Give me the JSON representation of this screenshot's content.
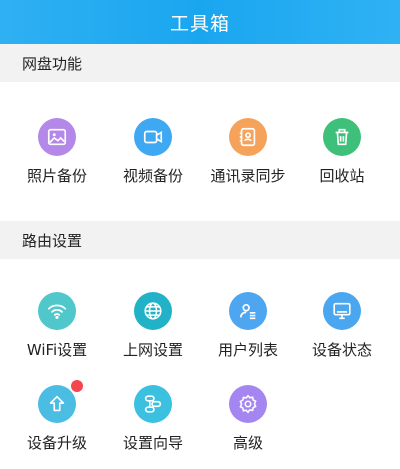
{
  "header": {
    "title": "工具箱"
  },
  "sections": [
    {
      "title": "网盘功能",
      "items": [
        {
          "label": "照片备份",
          "icon": "photo-icon",
          "color": "#b388e8"
        },
        {
          "label": "视频备份",
          "icon": "video-icon",
          "color": "#3fa8f2"
        },
        {
          "label": "通讯录同步",
          "icon": "contacts-icon",
          "color": "#f5a25b"
        },
        {
          "label": "回收站",
          "icon": "trash-icon",
          "color": "#3fc07a"
        }
      ]
    },
    {
      "title": "路由设置",
      "items": [
        {
          "label": "WiFi设置",
          "icon": "wifi-icon",
          "color": "#4fc7cb"
        },
        {
          "label": "上网设置",
          "icon": "globe-icon",
          "color": "#22b2c7"
        },
        {
          "label": "用户列表",
          "icon": "user-list-icon",
          "color": "#4ea6f0"
        },
        {
          "label": "设备状态",
          "icon": "monitor-icon",
          "color": "#4aa7ef"
        },
        {
          "label": "设备升级",
          "icon": "upgrade-icon",
          "color": "#4bbde3",
          "badge": true
        },
        {
          "label": "设置向导",
          "icon": "wizard-icon",
          "color": "#3cc0df"
        },
        {
          "label": "高级",
          "icon": "advanced-gear-icon",
          "color": "#a586f0"
        }
      ]
    }
  ]
}
